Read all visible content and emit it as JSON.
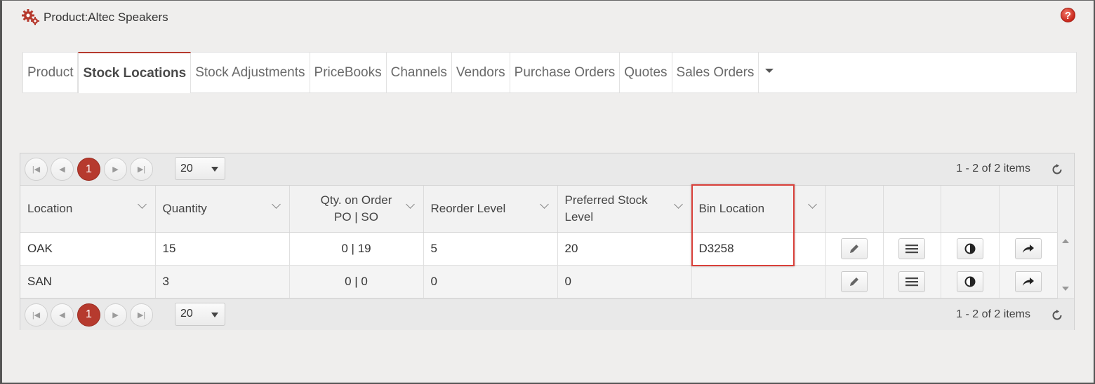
{
  "header": {
    "title": "Product:Altec Speakers",
    "help_label": "?"
  },
  "tabs": [
    {
      "label": "Product",
      "active": false
    },
    {
      "label": "Stock Locations",
      "active": true
    },
    {
      "label": "Stock Adjustments",
      "active": false
    },
    {
      "label": "PriceBooks",
      "active": false
    },
    {
      "label": "Channels",
      "active": false
    },
    {
      "label": "Vendors",
      "active": false
    },
    {
      "label": "Purchase Orders",
      "active": false
    },
    {
      "label": "Quotes",
      "active": false
    },
    {
      "label": "Sales Orders",
      "active": false
    }
  ],
  "pager": {
    "current_page": "1",
    "page_size": "20",
    "info": "1 - 2 of 2 items"
  },
  "columns": {
    "location": "Location",
    "quantity": "Quantity",
    "on_order_line1": "Qty. on Order",
    "on_order_line2": "PO | SO",
    "reorder": "Reorder Level",
    "preferred": "Preferred Stock Level",
    "bin": "Bin Location"
  },
  "rows": [
    {
      "location": "OAK",
      "quantity": "15",
      "on_order": "0 | 19",
      "reorder": "5",
      "preferred": "20",
      "bin": "D3258"
    },
    {
      "location": "SAN",
      "quantity": "3",
      "on_order": "0 | 0",
      "reorder": "0",
      "preferred": "0",
      "bin": ""
    }
  ],
  "icons": [
    "gears-icon",
    "help-icon",
    "edit-icon",
    "list-icon",
    "contrast-icon",
    "share-icon",
    "refresh-icon"
  ],
  "colors": {
    "accent": "#b63a2e",
    "highlight": "#d9403a"
  }
}
